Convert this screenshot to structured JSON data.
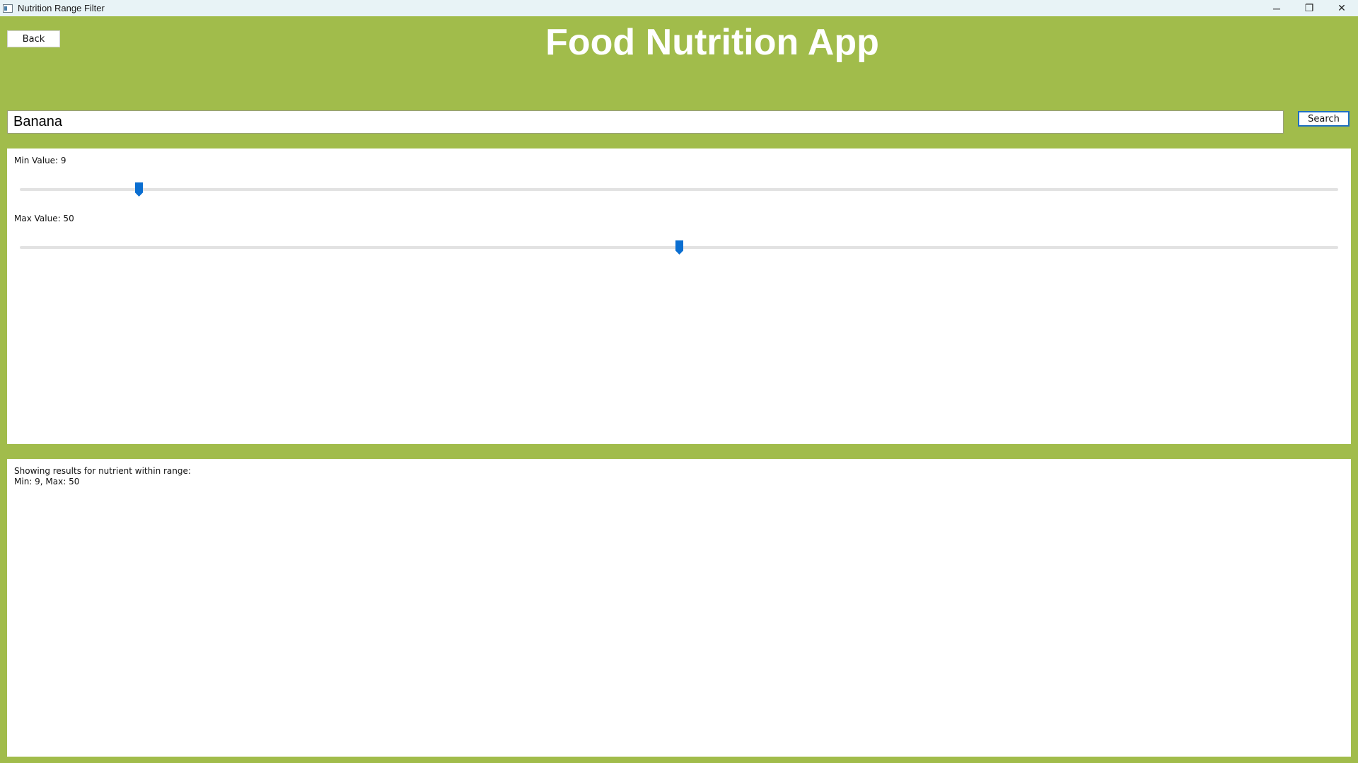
{
  "window": {
    "title": "Nutrition Range Filter",
    "controls": {
      "minimize": "─",
      "maximize": "❐",
      "close": "✕"
    }
  },
  "header": {
    "back_label": "Back",
    "title": "Food Nutrition App"
  },
  "search": {
    "value": "Banana",
    "button_label": "Search"
  },
  "filters": {
    "range_max": 100,
    "min": {
      "label": "Min Value: 9",
      "value": 9
    },
    "max": {
      "label": "Max Value: 50",
      "value": 50
    }
  },
  "results": {
    "line1": "Showing results for nutrient within range:",
    "line2": "Min: 9, Max: 50"
  },
  "colors": {
    "background": "#a1bc4b",
    "accent": "#0a6ed1"
  }
}
